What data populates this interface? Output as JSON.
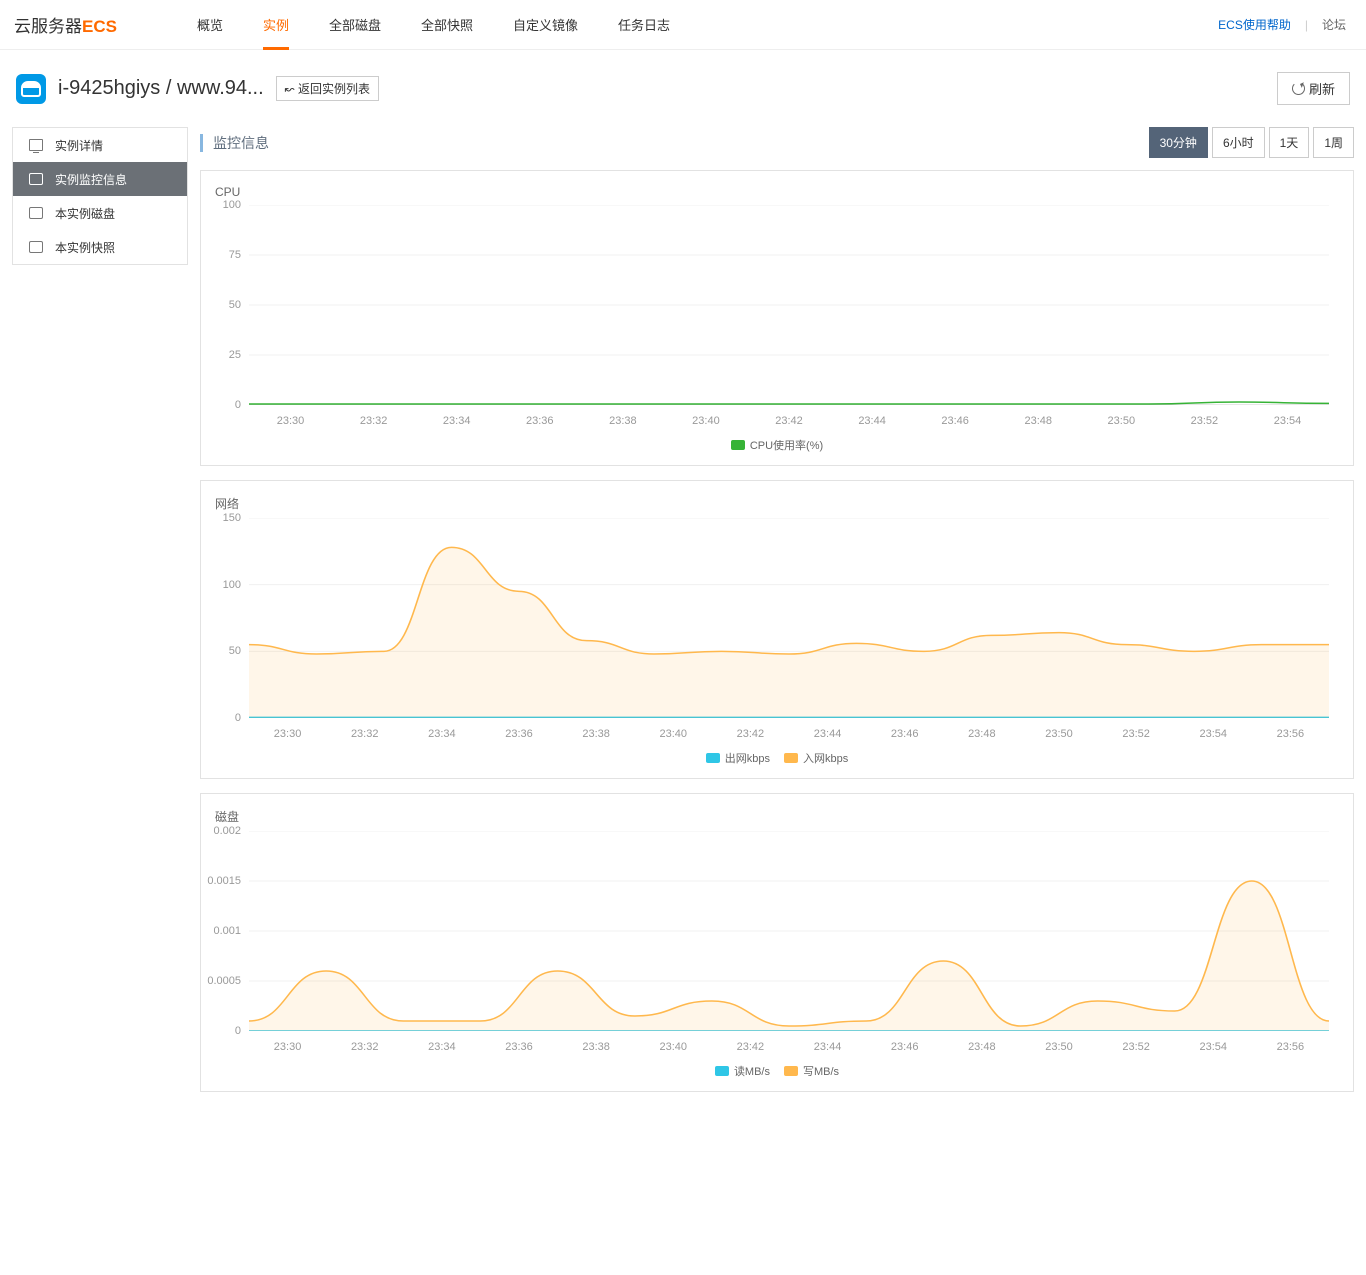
{
  "brand": {
    "prefix": "云服务器",
    "suffix": "ECS"
  },
  "topnav": {
    "items": [
      "概览",
      "实例",
      "全部磁盘",
      "全部快照",
      "自定义镜像",
      "任务日志"
    ],
    "active": 1
  },
  "top_right": {
    "help": "ECS使用帮助",
    "forum": "论坛"
  },
  "header": {
    "instance_id": "i-9425hgiys",
    "domain": "www.94...",
    "back": "↜ 返回实例列表",
    "refresh": "刷新"
  },
  "sidebar": {
    "items": [
      "实例详情",
      "实例监控信息",
      "本实例磁盘",
      "本实例快照"
    ],
    "active": 1
  },
  "section_title": "监控信息",
  "ranges": {
    "items": [
      "30分钟",
      "6小时",
      "1天",
      "1周"
    ],
    "active": 0
  },
  "colors": {
    "green": "#36b336",
    "orange": "#ffb84d",
    "cyan": "#2fc6e6"
  },
  "chart_data": [
    {
      "key": "cpu",
      "title": "CPU",
      "type": "line",
      "y_ticks": [
        0,
        25,
        50,
        75,
        100
      ],
      "ylim": [
        0,
        100
      ],
      "categories": [
        "23:30",
        "23:32",
        "23:34",
        "23:36",
        "23:38",
        "23:40",
        "23:42",
        "23:44",
        "23:46",
        "23:48",
        "23:50",
        "23:52",
        "23:54"
      ],
      "series": [
        {
          "name": "CPU使用率(%)",
          "color": "green",
          "fill": false,
          "values": [
            0.5,
            0.5,
            0.5,
            0.5,
            0.5,
            0.5,
            0.5,
            0.5,
            0.5,
            0.5,
            0.5,
            1.5,
            0.8
          ]
        }
      ]
    },
    {
      "key": "net",
      "title": "网络",
      "type": "area",
      "y_ticks": [
        0,
        50,
        100,
        150
      ],
      "ylim": [
        0,
        150
      ],
      "categories": [
        "23:30",
        "23:32",
        "23:34",
        "23:36",
        "23:38",
        "23:40",
        "23:42",
        "23:44",
        "23:46",
        "23:48",
        "23:50",
        "23:52",
        "23:54",
        "23:56"
      ],
      "series": [
        {
          "name": "出网kbps",
          "color": "cyan",
          "fill": false,
          "values": [
            0.5,
            0.5,
            0.5,
            0.5,
            0.5,
            0.5,
            0.5,
            0.5,
            0.5,
            0.5,
            0.5,
            0.5,
            0.5,
            0.5
          ]
        },
        {
          "name": "入网kbps",
          "color": "orange",
          "fill": true,
          "values": [
            55,
            48,
            50,
            128,
            95,
            58,
            48,
            50,
            48,
            56,
            50,
            62,
            64,
            55,
            50,
            55,
            55
          ]
        }
      ]
    },
    {
      "key": "disk",
      "title": "磁盘",
      "type": "area",
      "y_ticks": [
        0,
        0.0005,
        0.001,
        0.0015,
        0.002
      ],
      "ylim": [
        0,
        0.002
      ],
      "categories": [
        "23:30",
        "23:32",
        "23:34",
        "23:36",
        "23:38",
        "23:40",
        "23:42",
        "23:44",
        "23:46",
        "23:48",
        "23:50",
        "23:52",
        "23:54",
        "23:56"
      ],
      "series": [
        {
          "name": "读MB/s",
          "color": "cyan",
          "fill": false,
          "values": [
            0,
            0,
            0,
            0,
            0,
            0,
            0,
            0,
            0,
            0,
            0,
            0,
            0,
            0
          ]
        },
        {
          "name": "写MB/s",
          "color": "orange",
          "fill": true,
          "values": [
            0.0001,
            0.0006,
            0.0001,
            0.0001,
            0.0006,
            0.00015,
            0.0003,
            5e-05,
            0.0001,
            0.0007,
            5e-05,
            0.0003,
            0.0002,
            0.0015,
            0.0001
          ]
        }
      ]
    }
  ]
}
